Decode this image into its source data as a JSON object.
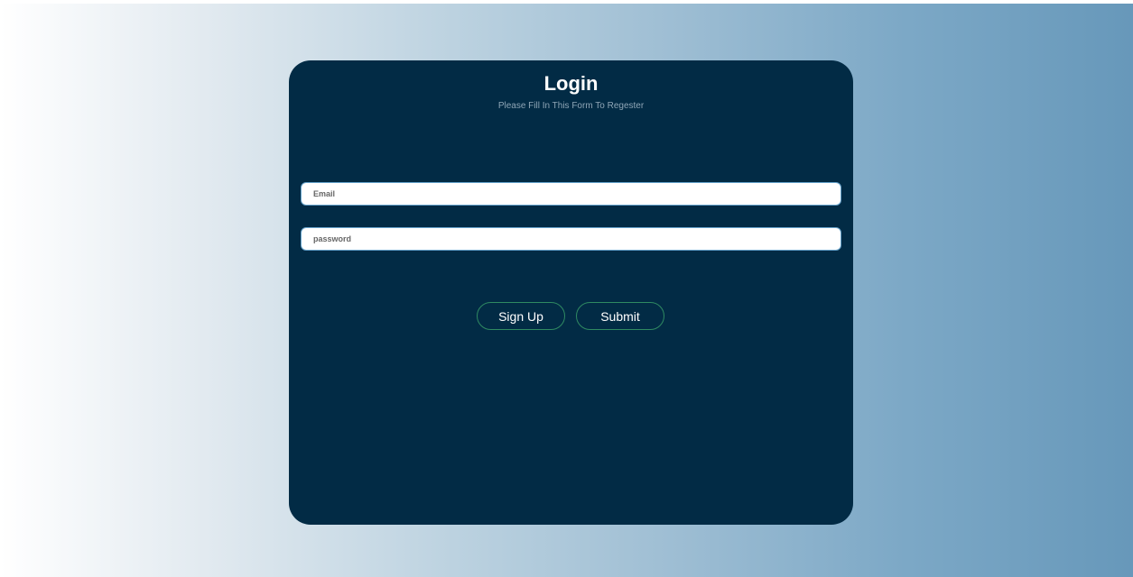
{
  "login_card": {
    "title": "Login",
    "subtitle": "Please Fill In This Form To Regester",
    "email_placeholder": "Email",
    "password_placeholder": "password",
    "signup_label": "Sign Up",
    "submit_label": "Submit"
  },
  "colors": {
    "card_background": "#022b45",
    "button_border": "#2f8a62",
    "input_border": "#66a3cc",
    "gradient_start": "#ffffff",
    "gradient_end": "#6798ba"
  }
}
